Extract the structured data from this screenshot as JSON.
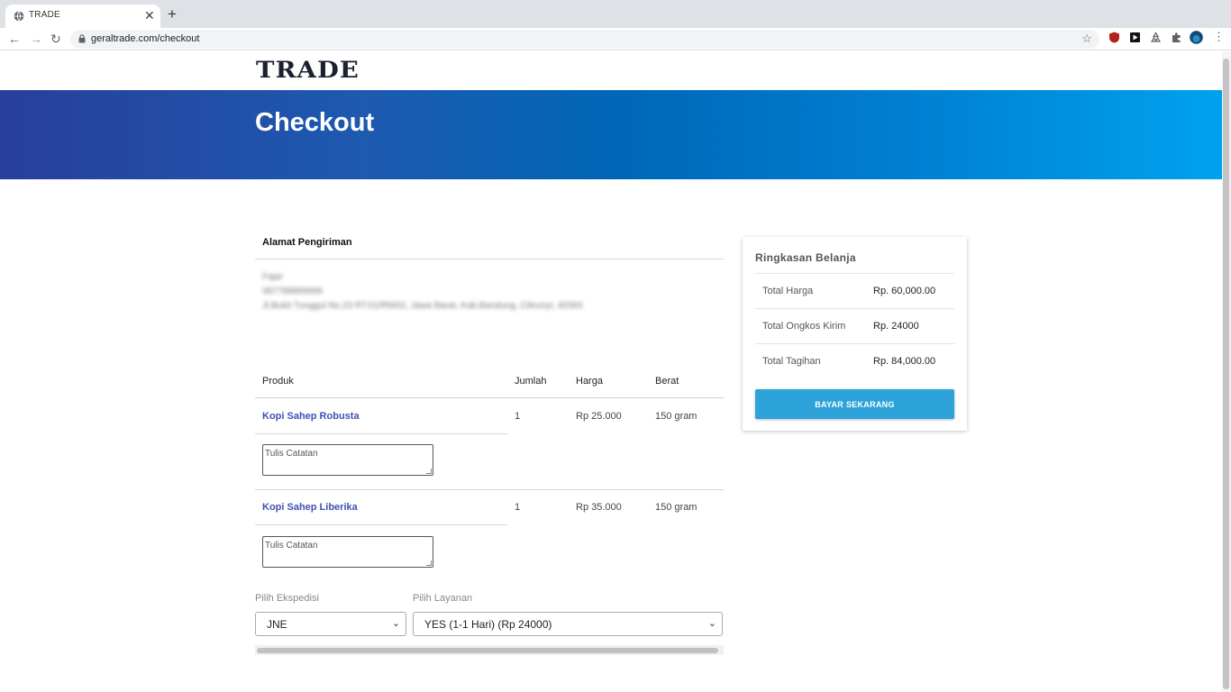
{
  "browser": {
    "tab_title": "TRADE",
    "tab_close": "✕",
    "new_tab": "+",
    "url": "geraltrade.com/checkout"
  },
  "site": {
    "logo": "TRADE",
    "page_title": "Checkout"
  },
  "shipping": {
    "title": "Alamat Pengiriman",
    "address_lines": [
      "Fajar",
      "087788889999",
      "Jl.Bukit Tunggul No.23 RT.01/RW02, Jawa Barat, Kab.Bandung, Cileunyi, 40393"
    ]
  },
  "table": {
    "headers": {
      "product": "Produk",
      "qty": "Jumlah",
      "price": "Harga",
      "weight": "Berat"
    },
    "rows": [
      {
        "product": "Kopi Sahep Robusta",
        "qty": "1",
        "price": "Rp 25.000",
        "weight": "150 gram",
        "note_placeholder": "Tulis Catatan"
      },
      {
        "product": "Kopi Sahep Liberika",
        "qty": "1",
        "price": "Rp 35.000",
        "weight": "150 gram",
        "note_placeholder": "Tulis Catatan"
      }
    ]
  },
  "expedition": {
    "label": "Pilih Ekspedisi",
    "value": "JNE"
  },
  "service": {
    "label": "Pilih Layanan",
    "value": "YES (1-1 Hari) (Rp 24000)"
  },
  "summary": {
    "title": "Ringkasan Belanja",
    "items": [
      {
        "label": "Total Harga",
        "value": "Rp. 60,000.00"
      },
      {
        "label": "Total Ongkos Kirim",
        "value": "Rp. 24000"
      },
      {
        "label": "Total Tagihan",
        "value": "Rp. 84,000.00"
      }
    ],
    "pay_button": "BAYAR SEKARANG"
  },
  "colors": {
    "accent": "#2ea3d9",
    "product_link": "#3f51b5",
    "banner_start": "#283f9b",
    "banner_end": "#00a2ee"
  }
}
